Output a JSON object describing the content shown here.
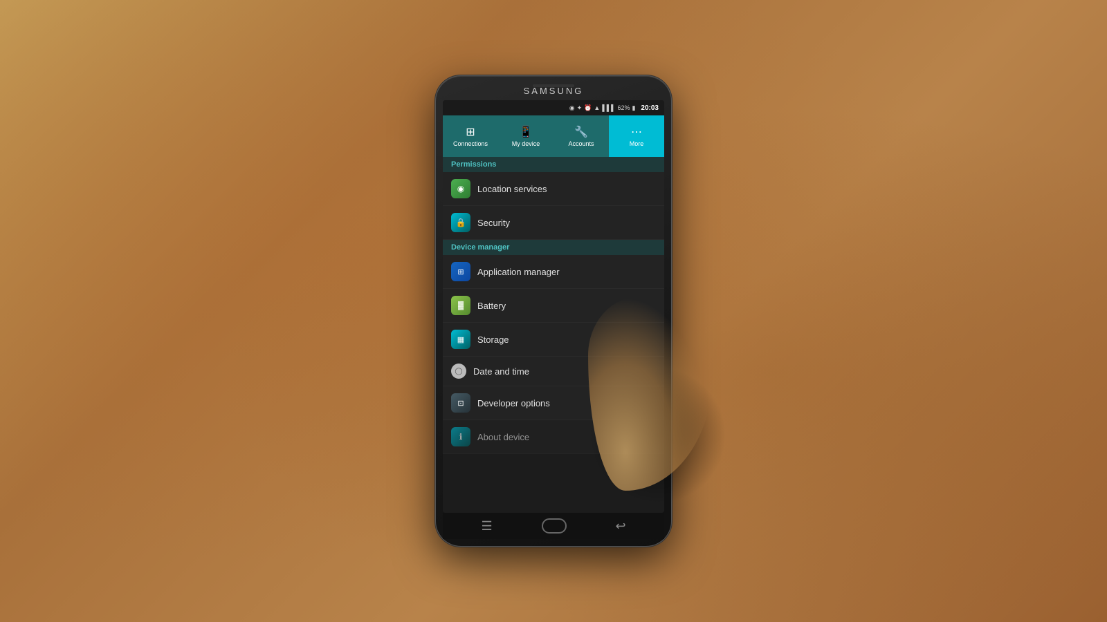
{
  "device": {
    "brand": "SAMSUNG",
    "status_bar": {
      "time": "20:03",
      "battery_percent": "62%"
    }
  },
  "tabs": [
    {
      "id": "connections",
      "label": "Connections",
      "icon": "⊞",
      "active": false
    },
    {
      "id": "my_device",
      "label": "My device",
      "icon": "📱",
      "active": false
    },
    {
      "id": "accounts",
      "label": "Accounts",
      "icon": "🔧",
      "active": false
    },
    {
      "id": "more",
      "label": "More",
      "icon": "⋯",
      "active": true
    }
  ],
  "sections": [
    {
      "header": "Permissions",
      "items": [
        {
          "id": "location_services",
          "label": "Location services",
          "icon_type": "green",
          "icon_char": "◉"
        },
        {
          "id": "security",
          "label": "Security",
          "icon_type": "teal",
          "icon_char": "🔒"
        }
      ]
    },
    {
      "header": "Device manager",
      "items": [
        {
          "id": "application_manager",
          "label": "Application manager",
          "icon_type": "blue",
          "icon_char": "⊞"
        },
        {
          "id": "battery",
          "label": "Battery",
          "icon_type": "lime",
          "icon_char": "▓"
        },
        {
          "id": "storage",
          "label": "Storage",
          "icon_type": "teal",
          "icon_char": "▦"
        },
        {
          "id": "date_and_time",
          "label": "Date and time",
          "icon_type": "circle",
          "icon_char": ""
        },
        {
          "id": "developer_options",
          "label": "Developer options",
          "icon_type": "dark",
          "icon_char": "⊡"
        },
        {
          "id": "about_device",
          "label": "About device",
          "icon_type": "teal",
          "icon_char": "ℹ"
        }
      ]
    }
  ],
  "nav": {
    "menu_icon": "☰",
    "back_icon": "↩"
  }
}
